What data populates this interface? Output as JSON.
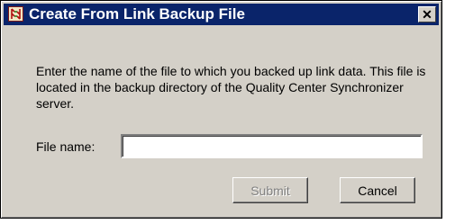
{
  "window": {
    "title": "Create From Link Backup File",
    "close_glyph": "✕",
    "app_icon": "link-sync-icon",
    "accent": "#0a246a",
    "background": "#d4d0c8"
  },
  "message": "Enter the name of the file to which you backed up link data. This file is located in the backup directory of the Quality Center Synchronizer server.",
  "file_field": {
    "label": "File name:",
    "value": "",
    "placeholder": ""
  },
  "buttons": {
    "submit_label": "Submit",
    "submit_enabled": false,
    "cancel_label": "Cancel"
  }
}
